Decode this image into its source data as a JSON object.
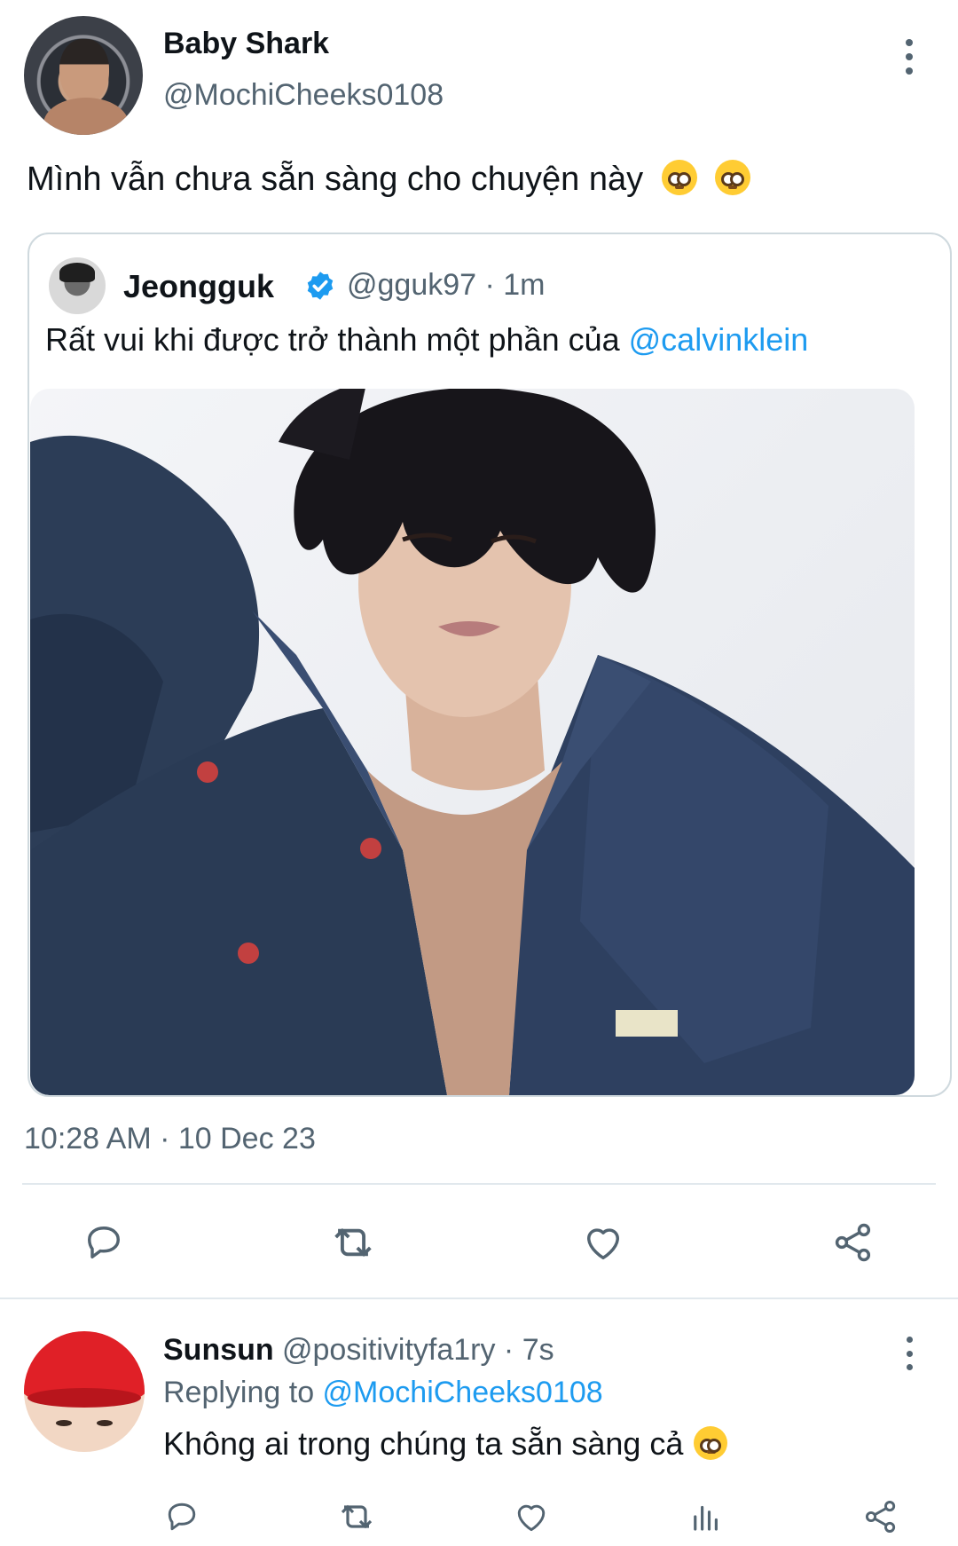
{
  "tweet": {
    "author_name": "Baby Shark",
    "author_handle": "@MochiCheeks0108",
    "text": "Mình vẫn chưa sẵn sàng cho chuyện này",
    "timestamp": "10:28 AM · 10 Dec 23",
    "quote": {
      "name": "Jeongguk",
      "handle_time": "@gguk97 · 1m",
      "text": "Rất vui khi được trở thành một phần của ",
      "mention": "@calvinklein"
    },
    "actions": {
      "reply": "reply-icon",
      "retweet": "retweet-icon",
      "like": "heart-icon",
      "share": "share-icon"
    }
  },
  "reply": {
    "author_name": "Sunsun",
    "meta": "@positivityfa1ry · 7s",
    "replying_label": "Replying to ",
    "replying_handle": "@MochiCheeks0108",
    "text": "Không ai trong chúng ta sẵn sàng cả"
  },
  "colors": {
    "accent": "#1d9bf0",
    "secondary_text": "#536471",
    "primary_text": "#0f1419",
    "border": "#cfd9de"
  }
}
